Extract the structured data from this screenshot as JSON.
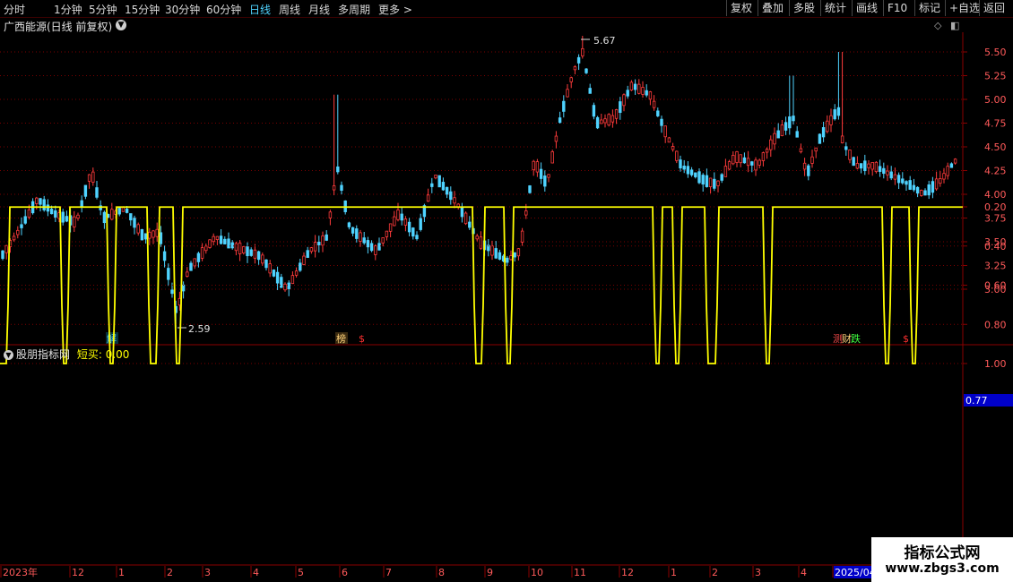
{
  "toolbar": {
    "period_tabs": [
      "分时",
      "1分钟",
      "5分钟",
      "15分钟",
      "30分钟",
      "60分钟",
      "日线",
      "周线",
      "月线",
      "多周期",
      "更多 >"
    ],
    "active_tab": "日线",
    "right_buttons": [
      "复权",
      "叠加",
      "多股",
      "统计",
      "画线",
      "F10",
      "标记",
      "+自选",
      "返回"
    ]
  },
  "main_chart": {
    "title": "广西能源(日线 前复权)",
    "y_ticks": [
      "5.50",
      "5.25",
      "5.00",
      "4.75",
      "4.50",
      "4.25",
      "4.00",
      "3.75",
      "3.50",
      "3.25",
      "3.00"
    ],
    "high_label": "5.67",
    "low_label": "2.59",
    "event_markers": [
      {
        "text": "解",
        "color": "#4fd3ff"
      },
      {
        "text": "榜",
        "color": "#ffd27a"
      },
      {
        "text": "$",
        "color": "#ff3030"
      },
      {
        "text": "测",
        "color": "#ff4d4d"
      },
      {
        "text": "财",
        "color": "#ffd27a"
      },
      {
        "text": "跌",
        "color": "#40ff40"
      },
      {
        "text": "$",
        "color": "#ff3030"
      }
    ],
    "up_color": "#ff3b3b",
    "down_color": "#4fd3ff"
  },
  "sub_chart": {
    "title": "股朋指标网",
    "value_label": "短买: 0.00",
    "y_ticks": [
      "1.00",
      "0.80",
      "0.60",
      "0.40",
      "0.20"
    ],
    "current_value": "0.77",
    "line_color": "#ffff00"
  },
  "chart_data": [
    {
      "type": "line",
      "title": "股朋指标网",
      "series": [
        {
          "name": "短买",
          "values": [
            0.0
          ]
        }
      ],
      "ylim": [
        0,
        1.0
      ],
      "pulse_centers_percent_of_range": [
        1,
        12,
        21,
        29,
        34,
        47,
        57,
        89,
        95,
        104,
        109,
        114,
        122,
        132,
        151,
        157
      ]
    }
  ],
  "time_axis": {
    "labels": [
      "2023年",
      "12",
      "1",
      "2",
      "3",
      "4",
      "5",
      "6",
      "7",
      "8",
      "9",
      "10",
      "11",
      "12",
      "1",
      "2",
      "3",
      "4",
      "2025/04"
    ],
    "highlight": "2025/04"
  },
  "watermark": {
    "title": "指标公式网",
    "url": "www.zbgs3.com"
  }
}
